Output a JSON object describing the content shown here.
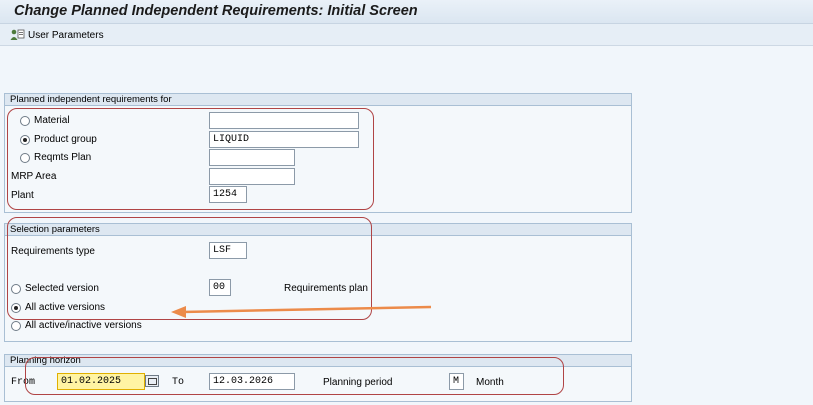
{
  "window": {
    "title": "Change Planned Independent Requirements: Initial Screen"
  },
  "toolbar": {
    "user_params_label": "User Parameters",
    "user_params_icon": "user-settings-icon"
  },
  "group_pir": {
    "header": "Planned independent requirements for",
    "material_label": "Material",
    "material_value": "",
    "product_group_label": "Product group",
    "product_group_value": "LIQUID",
    "reqmts_plan_label": "Reqmts Plan",
    "reqmts_plan_value": "",
    "mrp_area_label": "MRP Area",
    "mrp_area_value": "",
    "plant_label": "Plant",
    "plant_value": "1254",
    "selected_option": "Product group"
  },
  "group_sel": {
    "header": "Selection parameters",
    "req_type_label": "Requirements type",
    "req_type_value": "LSF",
    "selected_version_label": "Selected version",
    "selected_version_value": "00",
    "version_desc": "Requirements plan",
    "all_active_label": "All active versions",
    "all_active_inactive_label": "All active/inactive versions",
    "selected_option": "All active versions"
  },
  "group_horizon": {
    "header": "Planning horizon",
    "from_label": "From",
    "from_value": "01.02.2025",
    "to_label": "To",
    "to_value": "12.03.2026",
    "period_label": "Planning period",
    "period_value": "M",
    "period_desc": "Month"
  },
  "colors": {
    "highlight_box": "#b04445",
    "arrow": "#ec8b4a",
    "focus_field": "#fff4a3"
  }
}
